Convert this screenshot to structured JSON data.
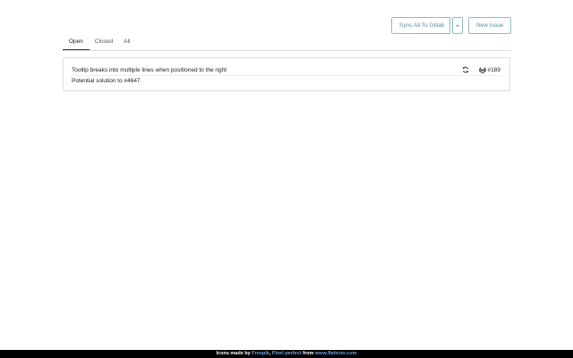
{
  "toolbar": {
    "sync_label": "Sync All To Gitlab",
    "new_issue_label": "New Issue"
  },
  "tabs": [
    {
      "label": "Open",
      "active": true
    },
    {
      "label": "Closed",
      "active": false
    },
    {
      "label": "All",
      "active": false
    }
  ],
  "issues": [
    {
      "title": "Tooltip breaks into multiple lines when positioned to the right",
      "ref": "#189",
      "body": "Potential solution to #4647",
      "icons": [
        "sync-icon",
        "gitlab-icon"
      ]
    }
  ],
  "footer": {
    "text1": "Icons made by ",
    "author1": "Freepik",
    "sep": ", ",
    "author2": "Pixel perfect",
    "text2": " from ",
    "site": "www.flaticon.com"
  },
  "colors": {
    "accent": "#5b8fa6",
    "border": "#93b9c8",
    "link": "#6fa3e0"
  }
}
